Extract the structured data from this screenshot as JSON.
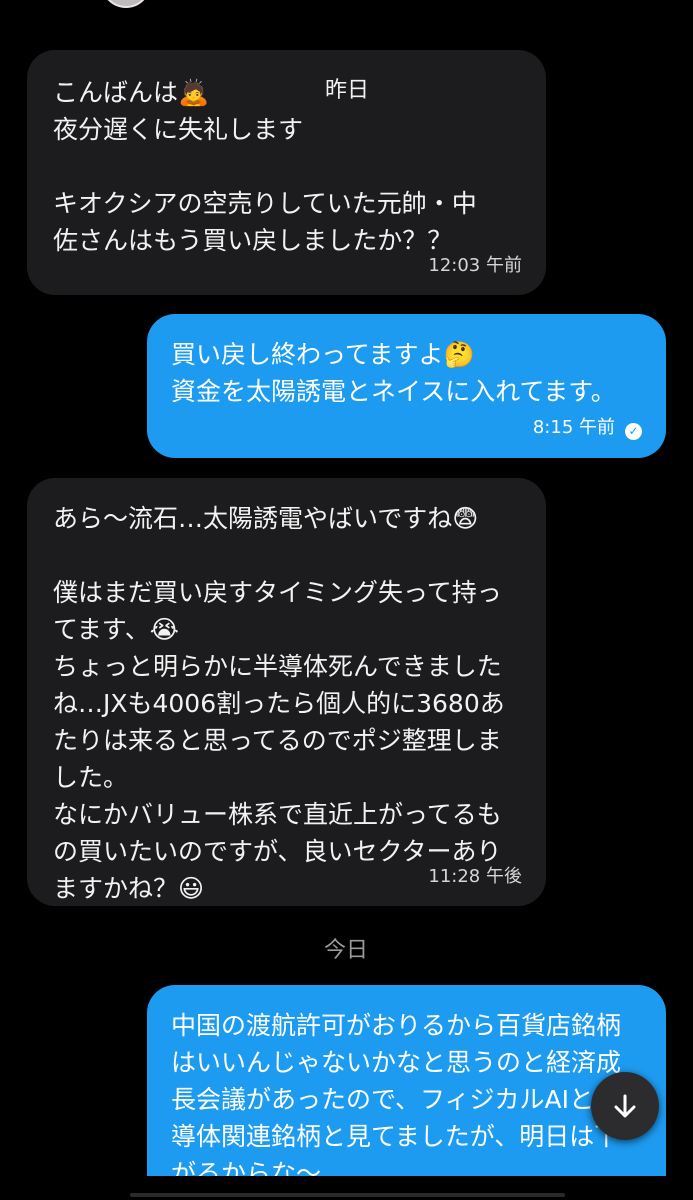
{
  "messages": [
    {
      "direction": "incoming",
      "text": "こんばんは🙇\n夜分遅くに失礼します\n\nキオクシアの空売りしていた元帥・中佐さんはもう買い戻しましたか？？",
      "day_label": "昨日",
      "time": "12:03 午前"
    },
    {
      "direction": "outgoing",
      "text": "買い戻し終わってますよ🤔\n資金を太陽誘電とネイスに入れてます。",
      "time": "8:15 午前"
    },
    {
      "direction": "incoming",
      "text": "あら〜流石…太陽誘電やばいですね😨\n\n僕はまだ買い戻すタイミング失って持ってます、😭\nちょっと明らかに半導体死んできましたね…JXも4006割ったら個人的に3680あたりは来ると思ってるのでポジ整理しました。\nなにかバリュー株系で直近上がってるもの買いたいのですが、良いセクターありますかね？😃",
      "time": "11:28 午後"
    },
    {
      "direction": "outgoing",
      "text": "中国の渡航許可がおりるから百貨店銘柄はいいんじゃないかなと思うのと経済成長会議があったので、フィジカルAIと半導体関連銘柄と見てましたが、明日は下がるからな〜"
    }
  ],
  "today_label": "今日",
  "colors": {
    "background": "#000000",
    "incoming_bubble": "#1c1c1e",
    "outgoing_bubble": "#1d9bf0",
    "text": "#f2f2f2"
  },
  "icons": {
    "read_receipt": "check-circle-icon",
    "scroll_down": "arrow-down-icon"
  }
}
